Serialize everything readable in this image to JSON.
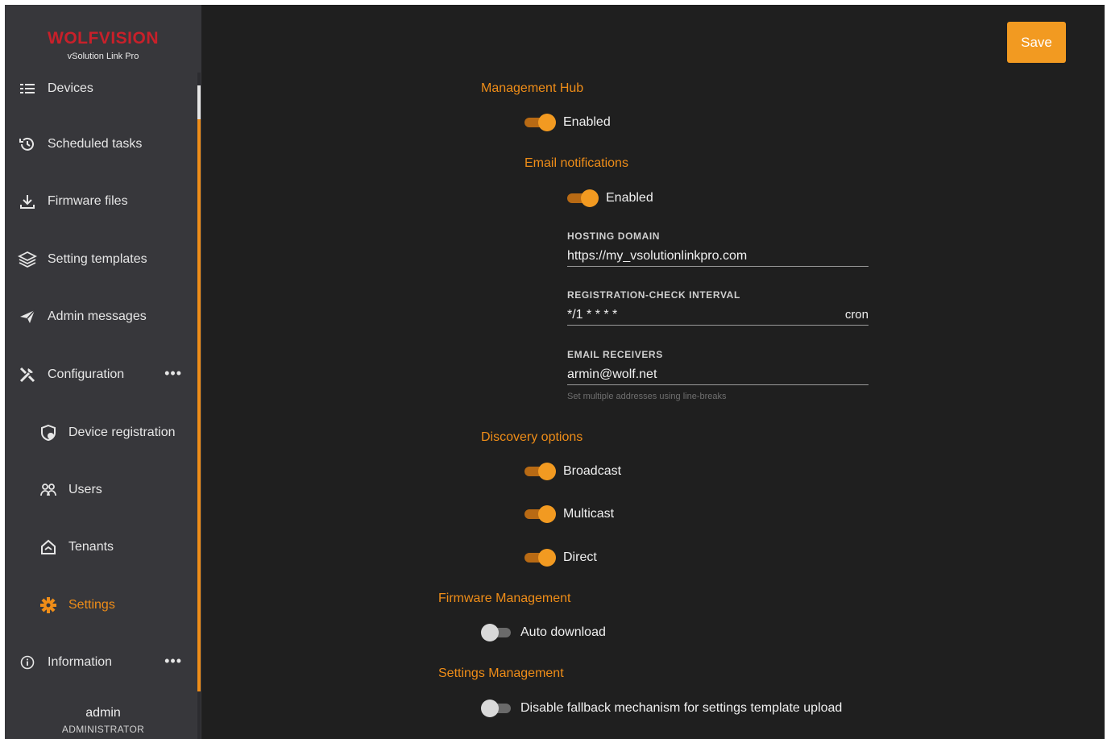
{
  "brand": {
    "logo": "WOLFVISION",
    "product": "vSolution Link Pro"
  },
  "sidebar": {
    "items": [
      {
        "label": "Devices",
        "icon": "list-icon"
      },
      {
        "label": "Scheduled tasks",
        "icon": "history-icon"
      },
      {
        "label": "Firmware files",
        "icon": "download-icon"
      },
      {
        "label": "Setting templates",
        "icon": "layers-icon"
      },
      {
        "label": "Admin messages",
        "icon": "send-icon"
      },
      {
        "label": "Configuration",
        "icon": "tools-icon",
        "more": "•••"
      },
      {
        "label": "Device registration",
        "icon": "shield-icon"
      },
      {
        "label": "Users",
        "icon": "users-icon"
      },
      {
        "label": "Tenants",
        "icon": "tenant-icon"
      },
      {
        "label": "Settings",
        "icon": "gear-icon"
      },
      {
        "label": "Information",
        "icon": "info-icon",
        "more": "•••"
      }
    ],
    "user": {
      "name": "admin",
      "role": "ADMINISTRATOR"
    }
  },
  "toolbar": {
    "save_label": "Save"
  },
  "settings": {
    "management_hub": {
      "title": "Management Hub",
      "enabled_label": "Enabled",
      "enabled": true
    },
    "email": {
      "title": "Email notifications",
      "enabled_label": "Enabled",
      "enabled": true,
      "hosting_domain_label": "HOSTING DOMAIN",
      "hosting_domain_value": "https://my_vsolutionlinkpro.com",
      "interval_label": "REGISTRATION-CHECK INTERVAL",
      "interval_value": "*/1 * * * *",
      "interval_suffix": "cron",
      "receivers_label": "EMAIL RECEIVERS",
      "receivers_value": "armin@wolf.net",
      "receivers_hint": "Set multiple addresses using line-breaks"
    },
    "discovery": {
      "title": "Discovery options",
      "broadcast_label": "Broadcast",
      "multicast_label": "Multicast",
      "direct_label": "Direct"
    },
    "firmware": {
      "title": "Firmware Management",
      "auto_download_label": "Auto download",
      "auto_download": false
    },
    "settings_mgmt": {
      "title": "Settings Management",
      "fallback_label": "Disable fallback mechanism for settings template upload",
      "fallback": false
    }
  },
  "colors": {
    "accent": "#ef8d18",
    "sidebar_bg": "#37373b",
    "main_bg": "#1f1f1f"
  }
}
